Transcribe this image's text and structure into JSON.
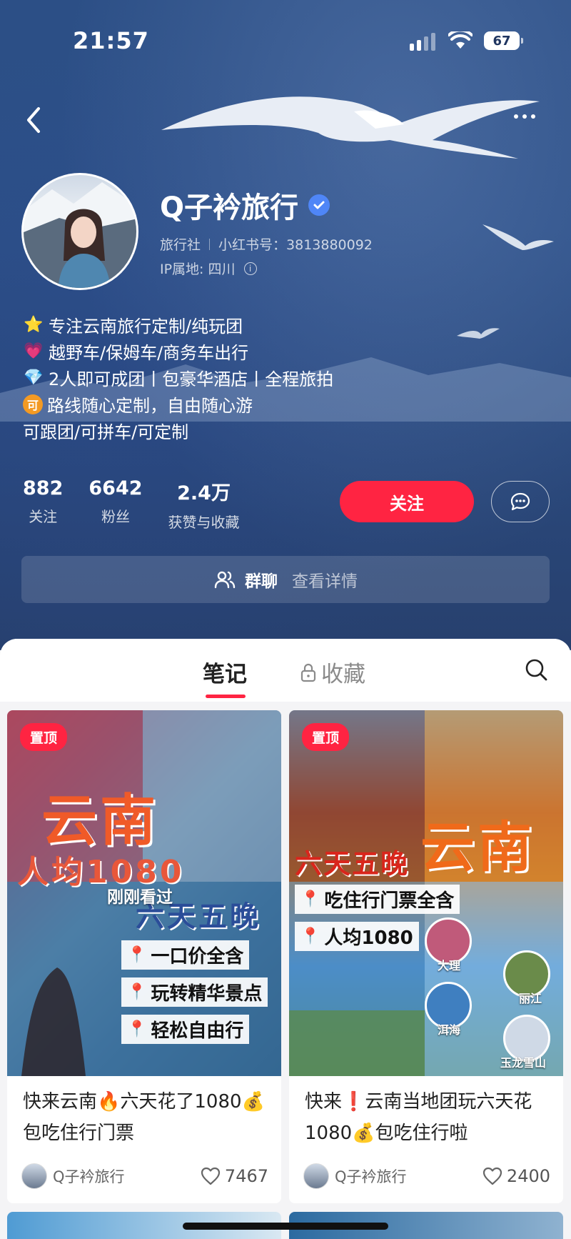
{
  "status_bar": {
    "time": "21:57",
    "battery": "67"
  },
  "profile": {
    "name": "Q子衿旅行",
    "category": "旅行社",
    "id_label": "小红书号：3813880092",
    "ip_label": "IP属地: 四川"
  },
  "bio": [
    {
      "emoji": "⭐",
      "text": "专注云南旅行定制/纯玩团"
    },
    {
      "emoji": "💗",
      "text": "越野车/保姆车/商务车出行"
    },
    {
      "emoji": "💎",
      "text": "2人即可成团丨包豪华酒店丨全程旅拍"
    },
    {
      "emoji": "可",
      "text": "路线随心定制，自由随心游"
    },
    {
      "emoji": "",
      "text": "可跟团/可拼车/可定制"
    }
  ],
  "stats": [
    {
      "value": "882",
      "label": "关注"
    },
    {
      "value": "6642",
      "label": "粉丝"
    },
    {
      "value": "2.4万",
      "label": "获赞与收藏"
    }
  ],
  "actions": {
    "follow": "关注"
  },
  "group_chat": {
    "label": "群聊",
    "detail": "查看详情"
  },
  "tabs": {
    "notes": "笔记",
    "collections": "收藏"
  },
  "cards": [
    {
      "badge": "置顶",
      "cover_title": "云南",
      "cover_price": "人均1080",
      "cover_days": "六天五晚",
      "seen_label": "刚刚看过",
      "tags": [
        "一口价全含",
        "玩转精华景点",
        "轻松自由行"
      ],
      "title": "快来云南🔥六天花了1080💰包吃住行门票",
      "author": "Q子衿旅行",
      "likes": "7467"
    },
    {
      "badge": "置顶",
      "cover_title": "云南",
      "cover_days": "六天五晚",
      "tags": [
        "吃住行门票全含",
        "人均1080"
      ],
      "places": [
        "大理",
        "丽江",
        "洱海",
        "玉龙雪山"
      ],
      "title": "快来❗云南当地团玩六天花1080💰包吃住行啦",
      "author": "Q子衿旅行",
      "likes": "2400"
    }
  ],
  "colors": {
    "accent": "#ff2442",
    "hero_bg": "#2c4f86"
  }
}
